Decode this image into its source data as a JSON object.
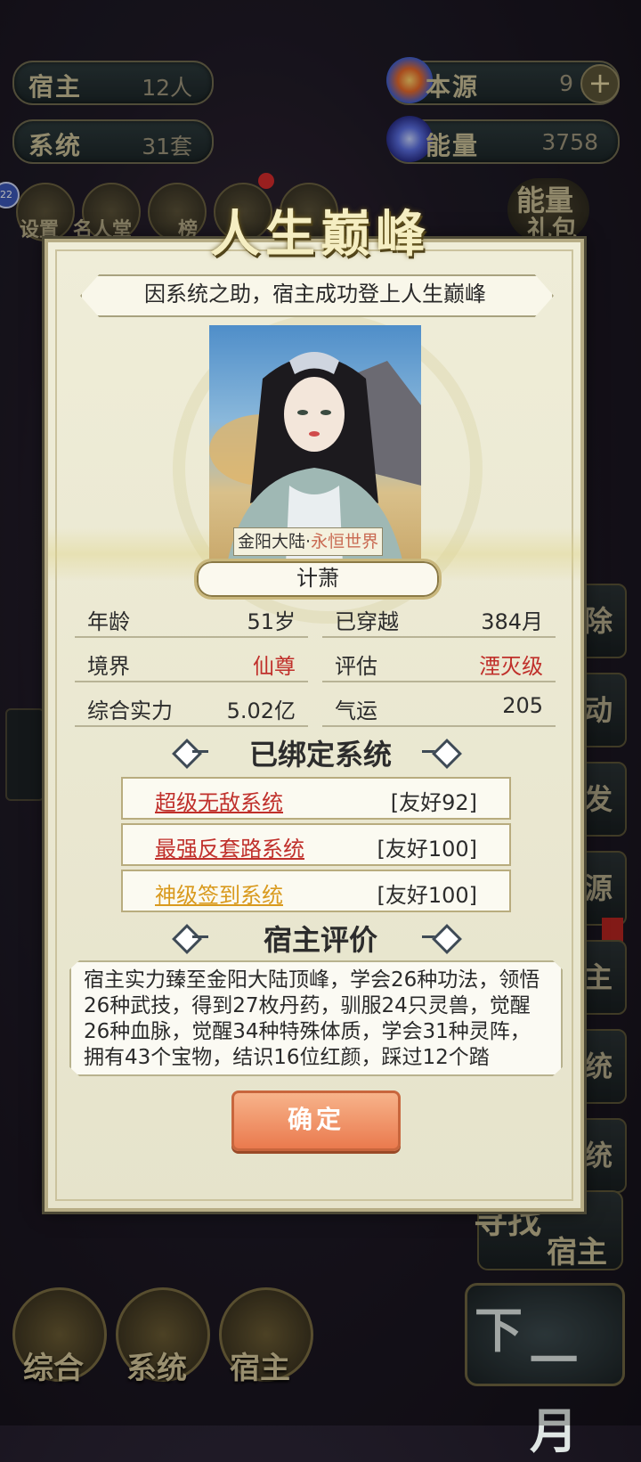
{
  "header": {
    "host_label": "宿主",
    "host_value": "12人",
    "system_label": "系统",
    "system_value": "31套",
    "origin_label": "本源",
    "origin_value": "9",
    "energy_label": "能量",
    "energy_value": "3758",
    "plus_symbol": "+"
  },
  "top_icons": {
    "badge": "22",
    "settings": "设置",
    "hall": "名人堂",
    "third": "榜",
    "energy_gift_line1": "能量",
    "energy_gift_line2": "礼包"
  },
  "side_buttons": [
    "除",
    "动",
    "发",
    "源",
    "主",
    "统",
    "统"
  ],
  "find_host": {
    "line1": "寻找",
    "line2": "宿主"
  },
  "next_month": {
    "line1": "下",
    "line2": "一月"
  },
  "bottom_nav": [
    "综合",
    "系统",
    "宿主"
  ],
  "modal": {
    "title": "人生巅峰",
    "banner": "因系统之助，宿主成功登上人生巅峰",
    "world_continent": "金阳大陆",
    "world_separator": "·",
    "world_realm": "永恒世界",
    "character_name": "计萧",
    "stats": [
      {
        "key": "年龄",
        "value": "51岁",
        "highlight": false
      },
      {
        "key": "已穿越",
        "value": "384月",
        "highlight": false
      },
      {
        "key": "境界",
        "value": "仙尊",
        "highlight": true
      },
      {
        "key": "评估",
        "value": "湮灭级",
        "highlight": true
      },
      {
        "key": "综合实力",
        "value": "5.02亿",
        "highlight": false
      },
      {
        "key": "气运",
        "value": "205",
        "highlight": false
      }
    ],
    "bound_systems_title": "已绑定系统",
    "systems": [
      {
        "name": "超级无敌系统",
        "friendship": "[友好92]",
        "color": "#c0302b"
      },
      {
        "name": "最强反套路系统",
        "friendship": "[友好100]",
        "color": "#c0302b"
      },
      {
        "name": "神级签到系统",
        "friendship": "[友好100]",
        "color": "#d99a1e"
      }
    ],
    "evaluation_title": "宿主评价",
    "evaluation_text": "宿主实力臻至金阳大陆顶峰，学会26种功法，领悟26种武技，得到27枚丹药，驯服24只灵兽，觉醒26种血脉，觉醒34种特殊体质，学会31种灵阵，拥有43个宝物，结识16位红颜，踩过12个踏",
    "confirm_label": "确定"
  }
}
